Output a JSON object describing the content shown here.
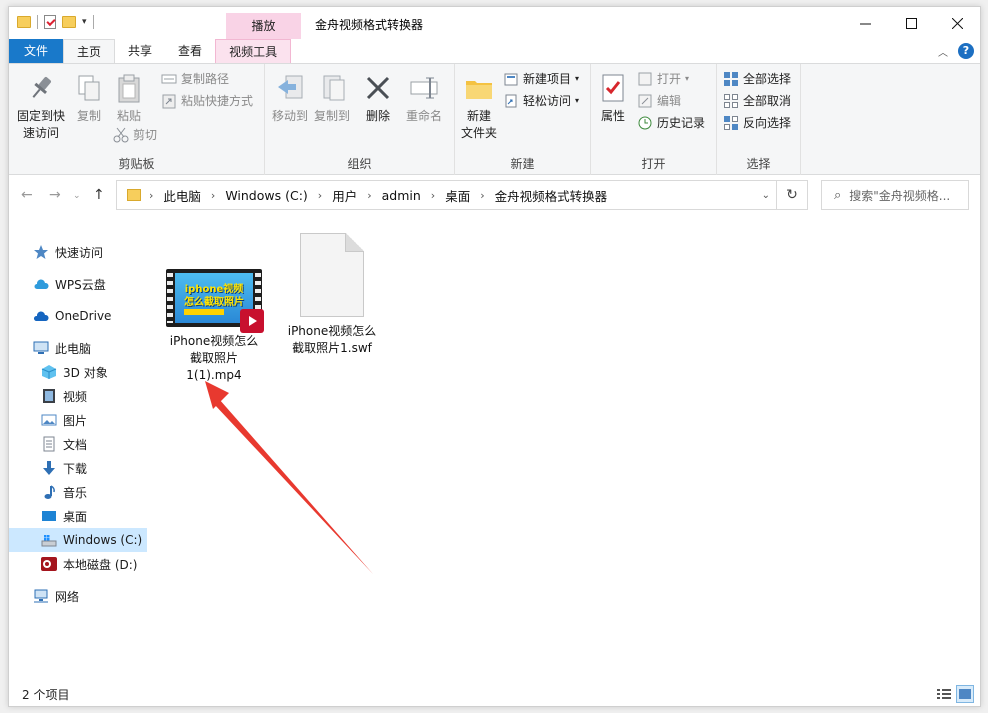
{
  "window": {
    "title": "金舟视频格式转换器",
    "context_tab_header": "播放"
  },
  "tabs": [
    {
      "label": "文件"
    },
    {
      "label": "主页"
    },
    {
      "label": "共享"
    },
    {
      "label": "查看"
    },
    {
      "label": "视频工具"
    }
  ],
  "ribbon": {
    "clipboard": {
      "label": "剪贴板",
      "pin": "固定到快\n速访问",
      "pin_l1": "固定到快",
      "pin_l2": "速访问",
      "copy": "复制",
      "paste": "粘贴",
      "copy_path": "复制路径",
      "paste_shortcut": "粘贴快捷方式",
      "cut": "剪切"
    },
    "organize": {
      "label": "组织",
      "move_to": "移动到",
      "copy_to": "复制到",
      "delete": "删除",
      "rename": "重命名"
    },
    "new": {
      "label": "新建",
      "new_folder_l1": "新建",
      "new_folder_l2": "文件夹",
      "new_item": "新建项目",
      "easy_access": "轻松访问"
    },
    "open": {
      "label": "打开",
      "properties": "属性",
      "open": "打开",
      "edit": "编辑",
      "history": "历史记录"
    },
    "select": {
      "label": "选择",
      "select_all": "全部选择",
      "select_none": "全部取消",
      "invert": "反向选择"
    }
  },
  "address": {
    "crumbs": [
      "此电脑",
      "Windows (C:)",
      "用户",
      "admin",
      "桌面",
      "金舟视频格式转换器"
    ],
    "search_placeholder": "搜索\"金舟视频格..."
  },
  "nav": {
    "quick_access": "快速访问",
    "wps": "WPS云盘",
    "onedrive": "OneDrive",
    "this_pc": "此电脑",
    "objects3d": "3D 对象",
    "videos": "视频",
    "pictures": "图片",
    "documents": "文档",
    "downloads": "下载",
    "music": "音乐",
    "desktop": "桌面",
    "drive_c": "Windows (C:)",
    "drive_d": "本地磁盘 (D:)",
    "network": "网络"
  },
  "files": [
    {
      "name": "iPhone视频怎么截取照片1(1).mp4",
      "line1": "iPhone视频怎么",
      "line2": "截取照片",
      "line3": "1(1).mp4",
      "thumb_text_1": "iphone视频",
      "thumb_text_2": "怎么截取照片"
    },
    {
      "name": "iPhone视频怎么截取照片1.swf",
      "line1": "iPhone视频怎么",
      "line2": "截取照片1.swf"
    }
  ],
  "status": {
    "item_count": "2 个项目"
  },
  "colors": {
    "accent": "#1979ca",
    "context_tab": "#f9d3e6",
    "selection": "#cce8ff",
    "annotation_arrow": "#e8392f"
  }
}
